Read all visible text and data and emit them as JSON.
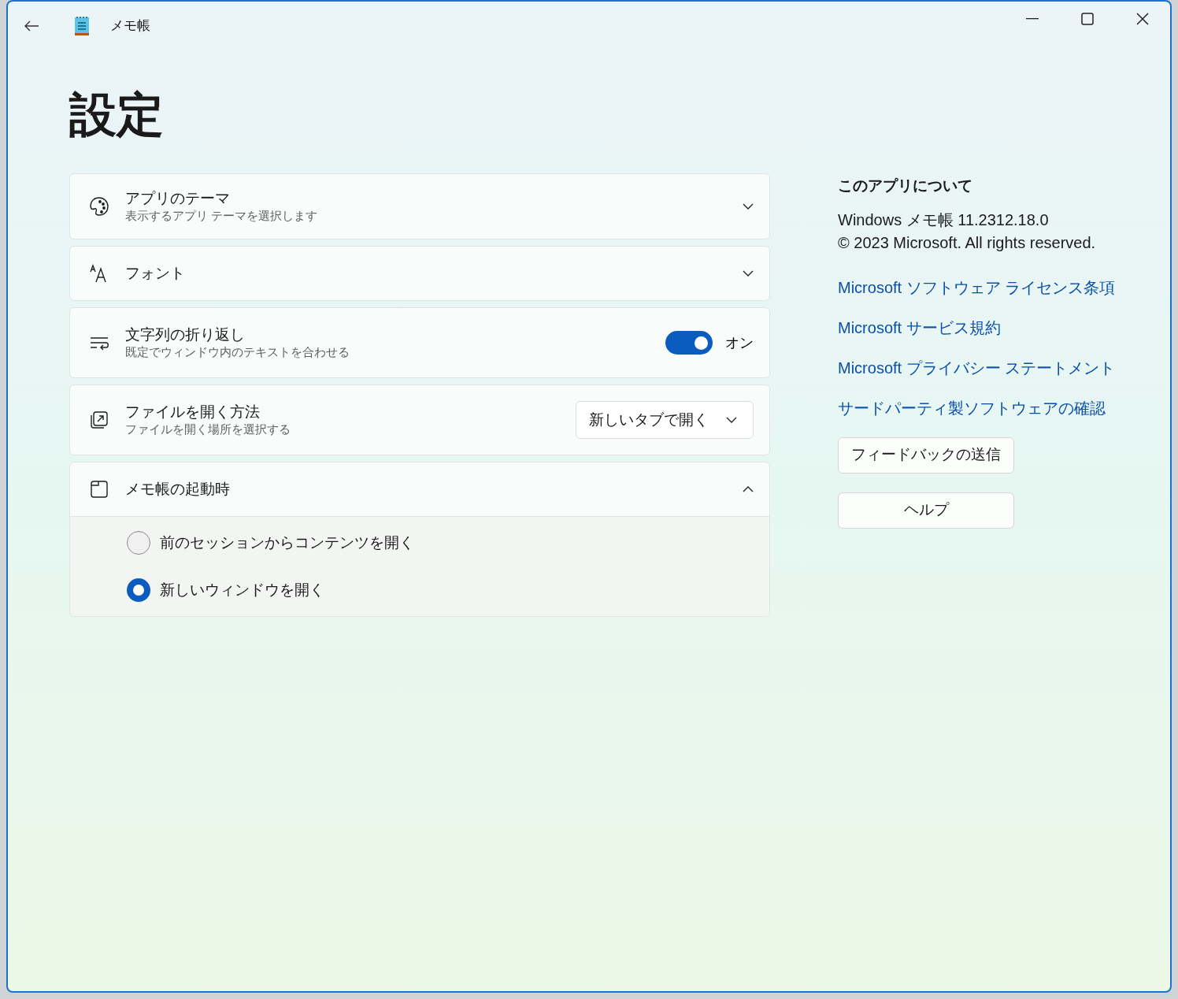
{
  "window": {
    "title": "メモ帳"
  },
  "heading": "設定",
  "settings": [
    {
      "kind": "expander",
      "title": "アプリのテーマ",
      "description": "表示するアプリ テーマを選択します",
      "expanded": false
    },
    {
      "kind": "expander",
      "title": "フォント",
      "expanded": false
    },
    {
      "kind": "toggle",
      "title": "文字列の折り返し",
      "description": "既定でウィンドウ内のテキストを合わせる",
      "on": true,
      "state_label": "オン"
    },
    {
      "kind": "dropdown",
      "title": "ファイルを開く方法",
      "description": "ファイルを開く場所を選択する",
      "value": "新しいタブで開く"
    },
    {
      "kind": "expander",
      "title": "メモ帳の起動時",
      "expanded": true,
      "options": [
        {
          "label": "前のセッションからコンテンツを開く",
          "selected": false
        },
        {
          "label": "新しいウィンドウを開く",
          "selected": true
        }
      ]
    }
  ],
  "about": {
    "heading": "このアプリについて",
    "version": "Windows メモ帳 11.2312.18.0",
    "copyright": "© 2023 Microsoft. All rights reserved.",
    "links": [
      "Microsoft ソフトウェア ライセンス条項",
      "Microsoft サービス規約",
      "Microsoft プライバシー ステートメント",
      "サードパーティ製ソフトウェアの確認"
    ],
    "buttons": [
      "フィードバックの送信",
      "ヘルプ"
    ]
  }
}
